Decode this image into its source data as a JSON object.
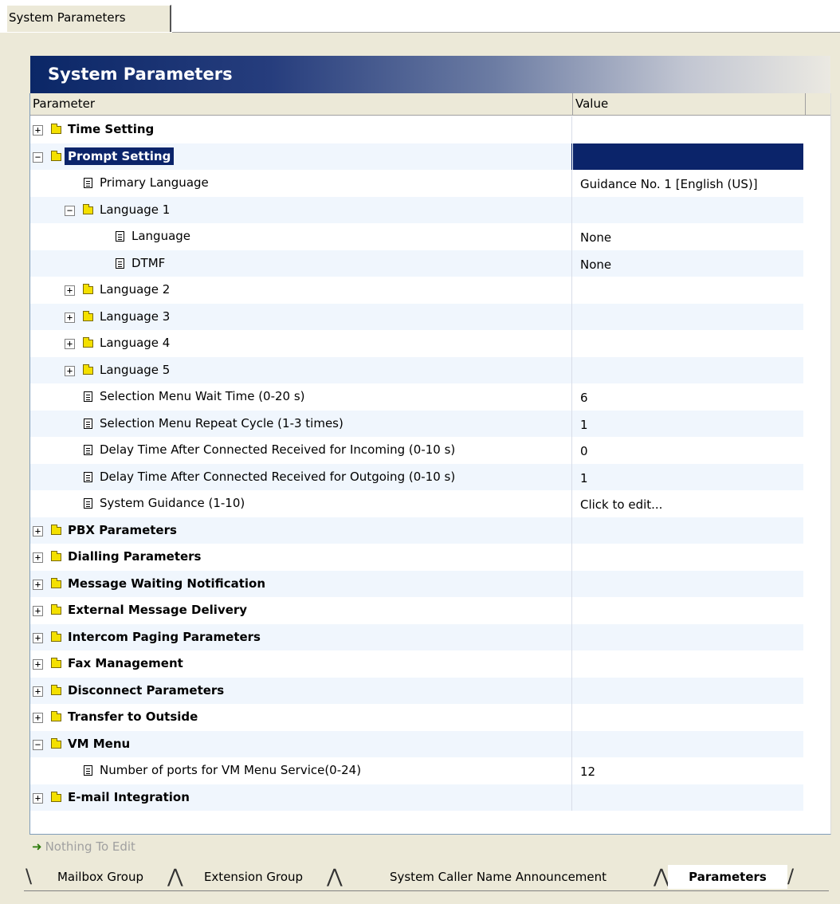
{
  "window": {
    "tab": "System Parameters"
  },
  "panel": {
    "title": "System Parameters"
  },
  "grid": {
    "headers": {
      "parameter": "Parameter",
      "value": "Value"
    },
    "rows": [
      {
        "type": "folder",
        "label": "Time Setting",
        "value": "",
        "level": 0,
        "bold": true,
        "expanded": false
      },
      {
        "type": "folder",
        "label": "Prompt Setting",
        "value": "",
        "level": 0,
        "bold": true,
        "expanded": true,
        "selected": true
      },
      {
        "type": "item",
        "label": "Primary Language",
        "value": "Guidance No. 1 [English (US)]",
        "level": 1
      },
      {
        "type": "folder",
        "label": "Language 1",
        "value": "",
        "level": 1,
        "expanded": true
      },
      {
        "type": "item",
        "label": "Language",
        "value": "None",
        "level": 2
      },
      {
        "type": "item",
        "label": "DTMF",
        "value": "None",
        "level": 2
      },
      {
        "type": "folder",
        "label": "Language 2",
        "value": "",
        "level": 1,
        "expanded": false
      },
      {
        "type": "folder",
        "label": "Language 3",
        "value": "",
        "level": 1,
        "expanded": false
      },
      {
        "type": "folder",
        "label": "Language 4",
        "value": "",
        "level": 1,
        "expanded": false
      },
      {
        "type": "folder",
        "label": "Language 5",
        "value": "",
        "level": 1,
        "expanded": false
      },
      {
        "type": "item",
        "label": "Selection Menu Wait Time (0-20 s)",
        "value": "6",
        "level": 1
      },
      {
        "type": "item",
        "label": "Selection Menu Repeat Cycle (1-3 times)",
        "value": "1",
        "level": 1
      },
      {
        "type": "item",
        "label": "Delay Time After Connected Received for Incoming (0-10 s)",
        "value": "0",
        "level": 1
      },
      {
        "type": "item",
        "label": "Delay Time After Connected Received for Outgoing (0-10 s)",
        "value": "1",
        "level": 1
      },
      {
        "type": "item",
        "label": "System Guidance (1-10)",
        "value": "Click to edit...",
        "level": 1
      },
      {
        "type": "folder",
        "label": "PBX Parameters",
        "value": "",
        "level": 0,
        "bold": true,
        "expanded": false
      },
      {
        "type": "folder",
        "label": "Dialling Parameters",
        "value": "",
        "level": 0,
        "bold": true,
        "expanded": false
      },
      {
        "type": "folder",
        "label": "Message Waiting Notification",
        "value": "",
        "level": 0,
        "bold": true,
        "expanded": false
      },
      {
        "type": "folder",
        "label": "External Message Delivery",
        "value": "",
        "level": 0,
        "bold": true,
        "expanded": false
      },
      {
        "type": "folder",
        "label": "Intercom Paging Parameters",
        "value": "",
        "level": 0,
        "bold": true,
        "expanded": false
      },
      {
        "type": "folder",
        "label": "Fax Management",
        "value": "",
        "level": 0,
        "bold": true,
        "expanded": false
      },
      {
        "type": "folder",
        "label": "Disconnect Parameters",
        "value": "",
        "level": 0,
        "bold": true,
        "expanded": false
      },
      {
        "type": "folder",
        "label": "Transfer to Outside",
        "value": "",
        "level": 0,
        "bold": true,
        "expanded": false
      },
      {
        "type": "folder",
        "label": "VM Menu",
        "value": "",
        "level": 0,
        "bold": true,
        "expanded": true
      },
      {
        "type": "item",
        "label": "Number of ports for VM Menu Service(0-24)",
        "value": "12",
        "level": 1
      },
      {
        "type": "folder",
        "label": "E-mail Integration",
        "value": "",
        "level": 0,
        "bold": true,
        "expanded": false
      }
    ]
  },
  "status": {
    "text": "Nothing To Edit",
    "icon": "arrow-right-icon"
  },
  "bottom_tabs": [
    {
      "label": "Mailbox Group",
      "active": false
    },
    {
      "label": "Extension Group",
      "active": false
    },
    {
      "label": "System Caller Name Announcement",
      "active": false
    },
    {
      "label": "Parameters",
      "active": true
    }
  ],
  "colors": {
    "selection": "#0b246a",
    "alt_row": "#f0f6fd",
    "chrome": "#ece9d8",
    "title_gradient_start": "#0b2767"
  }
}
